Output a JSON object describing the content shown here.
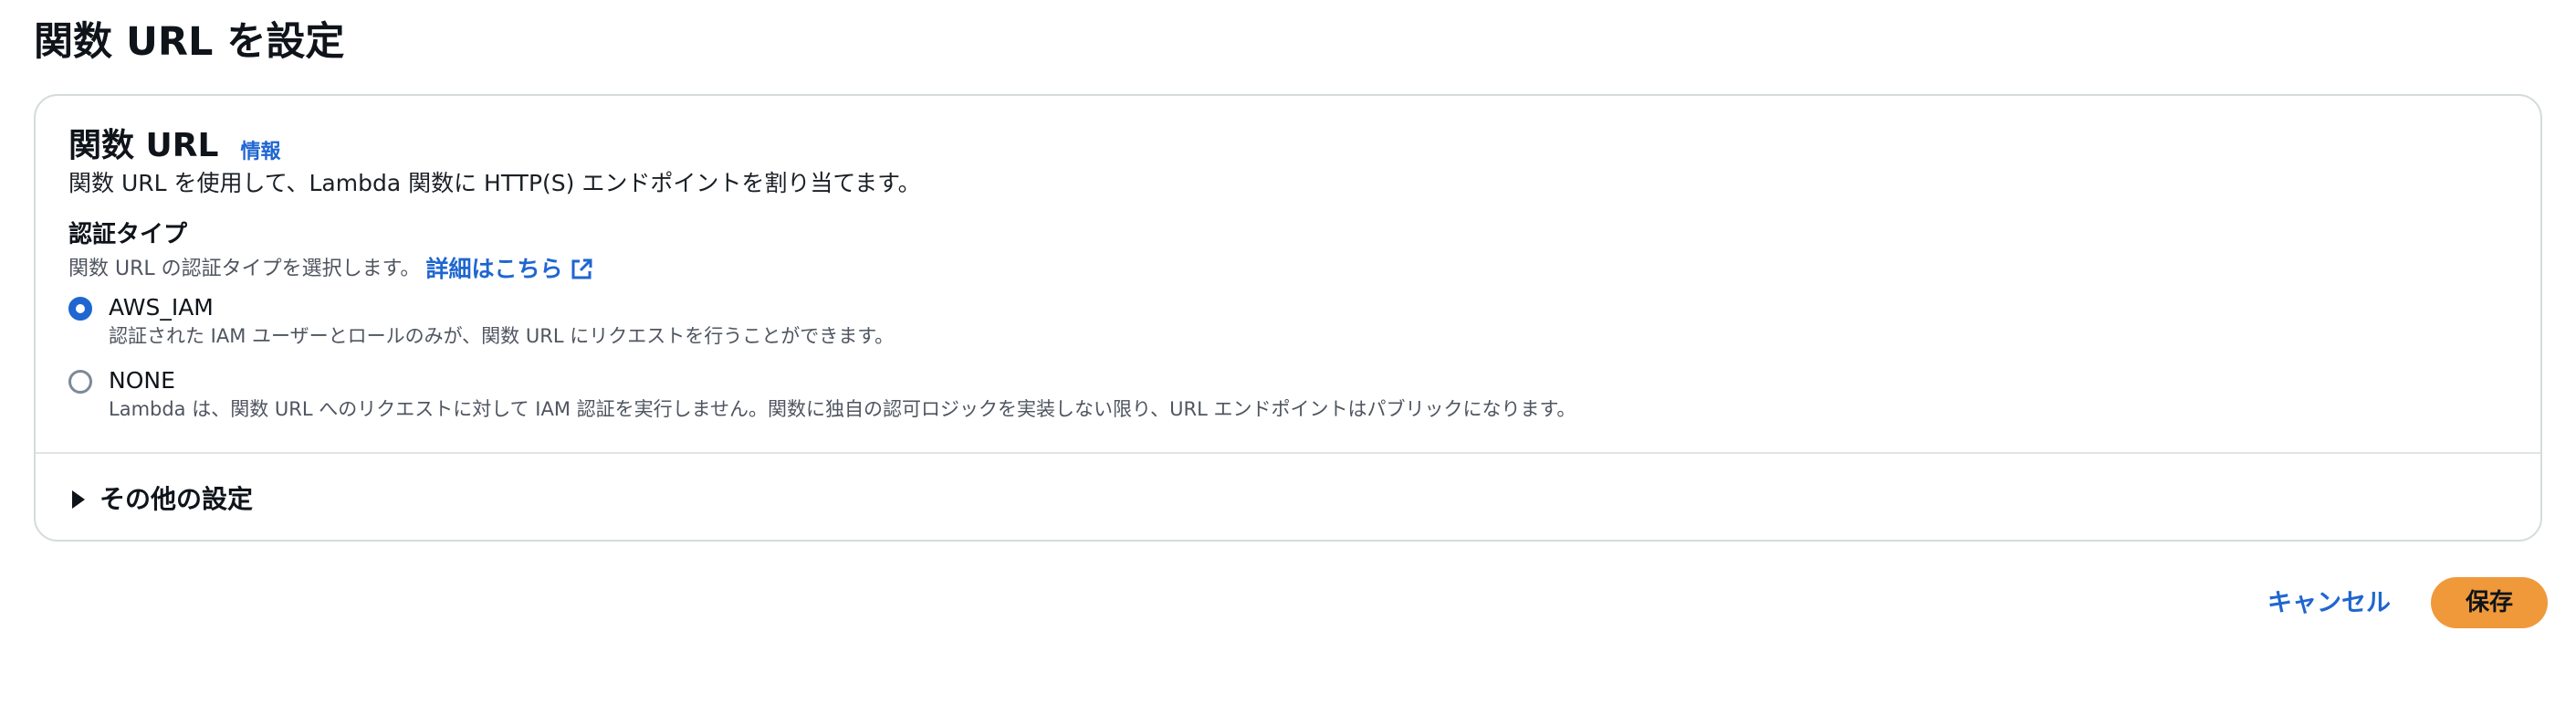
{
  "page": {
    "title": "関数 URL を設定"
  },
  "panel": {
    "title": "関数 URL",
    "info_link": "情報",
    "description": "関数 URL を使用して、Lambda 関数に HTTP(S) エンドポイントを割り当てます。"
  },
  "auth": {
    "label": "認証タイプ",
    "description": "関数 URL の認証タイプを選択します。",
    "learn_more_link": "詳細はこちら",
    "learn_more_icon": "external-link-icon",
    "options": [
      {
        "label": "AWS_IAM",
        "hint": "認証された IAM ユーザーとロールのみが、関数 URL にリクエストを行うことができます。",
        "selected": true
      },
      {
        "label": "NONE",
        "hint": "Lambda は、関数 URL へのリクエストに対して IAM 認証を実行しません。関数に独自の認可ロジックを実装しない限り、URL エンドポイントはパブリックになります。",
        "selected": false
      }
    ]
  },
  "additional_settings": {
    "label": "その他の設定",
    "icon": "caret-right-icon"
  },
  "actions": {
    "cancel_label": "キャンセル",
    "save_label": "保存"
  },
  "colors": {
    "accent": "#1f66d0",
    "primary_button": "#f0993a",
    "border": "#d5dbdb"
  }
}
